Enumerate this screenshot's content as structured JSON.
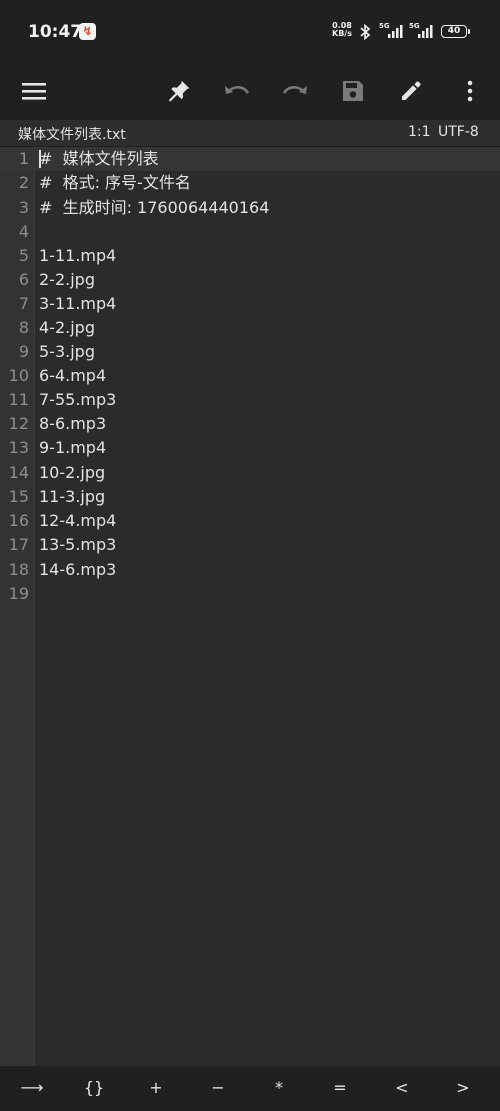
{
  "status_bar": {
    "time": "10:47",
    "app_badge": "↯",
    "net_speed_value": "0.08",
    "net_speed_unit": "KB/s",
    "signal1_label": "5G",
    "signal2_label": "5G",
    "battery": "40"
  },
  "toolbar": {
    "icons": [
      "menu-icon",
      "pin-icon",
      "undo-icon",
      "redo-icon",
      "save-icon",
      "edit-icon",
      "more-vert-icon"
    ]
  },
  "file": {
    "name": "媒体文件列表.txt",
    "cursor": "1:1",
    "encoding": "UTF-8"
  },
  "editor": {
    "lines": [
      {
        "num": "1",
        "text": "#  媒体文件列表"
      },
      {
        "num": "2",
        "text": "#  格式: 序号-文件名"
      },
      {
        "num": "3",
        "text": "#  生成时间: 1760064440164"
      },
      {
        "num": "4",
        "text": ""
      },
      {
        "num": "5",
        "text": "1-11.mp4"
      },
      {
        "num": "6",
        "text": "2-2.jpg"
      },
      {
        "num": "7",
        "text": "3-11.mp4"
      },
      {
        "num": "8",
        "text": "4-2.jpg"
      },
      {
        "num": "9",
        "text": "5-3.jpg"
      },
      {
        "num": "10",
        "text": "6-4.mp4"
      },
      {
        "num": "11",
        "text": "7-55.mp3"
      },
      {
        "num": "12",
        "text": "8-6.mp3"
      },
      {
        "num": "13",
        "text": "9-1.mp4"
      },
      {
        "num": "14",
        "text": "10-2.jpg"
      },
      {
        "num": "15",
        "text": "11-3.jpg"
      },
      {
        "num": "16",
        "text": "12-4.mp4"
      },
      {
        "num": "17",
        "text": "13-5.mp3"
      },
      {
        "num": "18",
        "text": "14-6.mp3"
      },
      {
        "num": "19",
        "text": ""
      }
    ]
  },
  "bottom_keys": [
    "⟶",
    "{}",
    "+",
    "−",
    "*",
    "=",
    "<",
    ">"
  ],
  "colors": {
    "background": "#2b2b2b",
    "toolbar": "#202020",
    "gutter": "#333333",
    "text": "#e3e3e3",
    "line_number": "#8f8f8f",
    "disabled_icon": "#7a7a7a"
  }
}
